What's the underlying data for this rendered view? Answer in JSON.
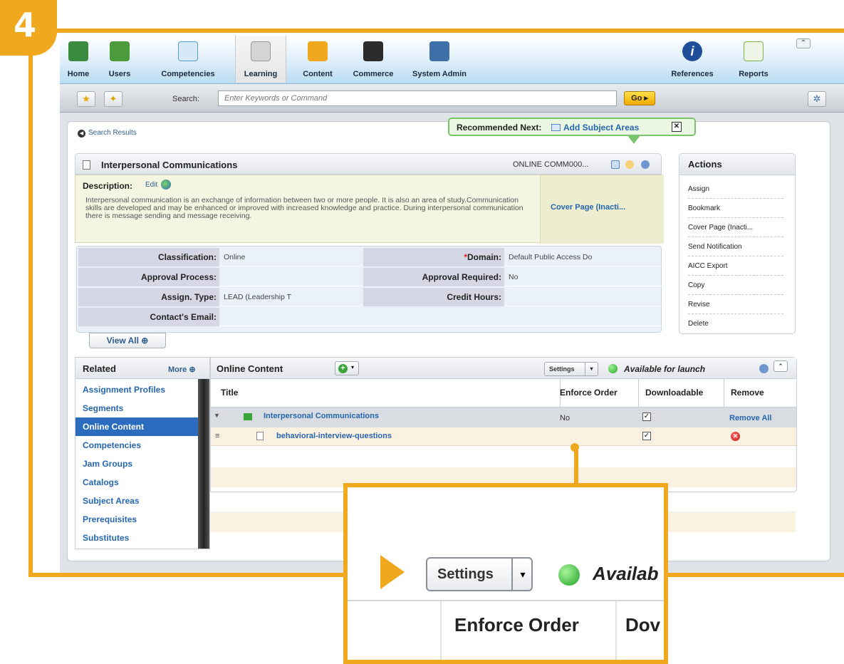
{
  "step": "4",
  "topnav": {
    "items": [
      {
        "label": "Home",
        "icon": "home-icon",
        "color": "#3a8a3f"
      },
      {
        "label": "Users",
        "icon": "users-icon",
        "color": "#4d9c3b"
      },
      {
        "label": "Competencies",
        "icon": "competencies-icon",
        "color": "#5c9fcf"
      },
      {
        "label": "Learning",
        "icon": "learning-icon",
        "color": "#bcbcbc"
      },
      {
        "label": "Content",
        "icon": "content-folder-icon",
        "color": "#f0a81e"
      },
      {
        "label": "Commerce",
        "icon": "commerce-briefcase-icon",
        "color": "#2c2c2c"
      },
      {
        "label": "System Admin",
        "icon": "system-admin-icon",
        "color": "#3f6fa8"
      },
      {
        "label": "References",
        "icon": "references-info-icon",
        "color": "#1f4f9a"
      },
      {
        "label": "Reports",
        "icon": "reports-chart-icon",
        "color": "#7ab34a"
      }
    ],
    "active": "Learning"
  },
  "search": {
    "label": "Search:",
    "placeholder": "Enter Keywords or Command",
    "go_label": "Go ▸"
  },
  "breadcrumb": "Search Results",
  "recommended": {
    "prefix": "Recommended Next:",
    "link": "Add Subject Areas",
    "close": "✕"
  },
  "item": {
    "title": "Interpersonal Communications",
    "code": "ONLINE COMM000..."
  },
  "description": {
    "label": "Description:",
    "edit": "Edit",
    "text": "Interpersonal communication is an exchange of information between two or more people. It is also an area of study.Communication skills are developed and may be enhanced or improved with increased knowledge and practice. During interpersonal communication there is message sending and message receiving.",
    "cover_link": "Cover Page (Inacti..."
  },
  "properties": [
    {
      "label": "Classification:",
      "value": "Online",
      "label2": "Domain:",
      "required2": "*",
      "value2": "Default Public Access Do"
    },
    {
      "label": "Approval Process:",
      "value": "",
      "label2": "Approval Required:",
      "required2": "",
      "value2": "No"
    },
    {
      "label": "Assign. Type:",
      "value": "LEAD (Leadership T",
      "label2": "Credit Hours:",
      "required2": "",
      "value2": ""
    },
    {
      "label": "Contact's Email:",
      "value": "",
      "label2": "",
      "required2": "",
      "value2": ""
    }
  ],
  "view_all": "View All ⊕",
  "actions": {
    "title": "Actions",
    "items": [
      "Assign",
      "Bookmark",
      "Cover Page (Inacti...",
      "Send Notification",
      "AICC Export",
      "Copy",
      "Revise",
      "Delete"
    ]
  },
  "related": {
    "title": "Related",
    "more": "More ⊕",
    "items": [
      "Assignment Profiles",
      "Segments",
      "Online Content",
      "Competencies",
      "Jam Groups",
      "Catalogs",
      "Subject Areas",
      "Prerequisites",
      "Substitutes"
    ],
    "selected": "Online Content"
  },
  "online": {
    "title": "Online Content",
    "settings": "Settings",
    "status": "Available for launch",
    "columns": [
      "Title",
      "Enforce Order",
      "Downloadable",
      "Remove"
    ],
    "group": {
      "title": "Interpersonal Communications",
      "enforce": "No",
      "downloadable": "✓",
      "remove": "Remove All"
    },
    "row": {
      "title": "behavioral-interview-questions",
      "downloadable": "✓",
      "remove": "✕"
    }
  },
  "zoom": {
    "settings": "Settings",
    "status": "Availab",
    "col1": "Enforce Order",
    "col2": "Dov"
  },
  "colors": {
    "accent": "#f0a81e",
    "selected": "#2c6cbf",
    "link": "#2566b0"
  }
}
